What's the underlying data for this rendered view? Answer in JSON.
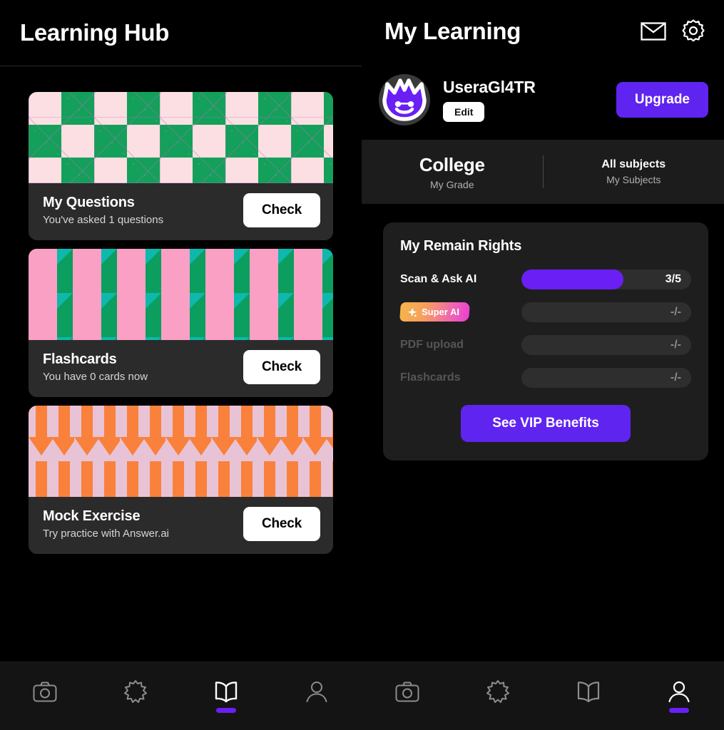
{
  "left": {
    "header_title": "Learning Hub",
    "cards": [
      {
        "title": "My Questions",
        "subtitle": "You've asked 1 questions",
        "button": "Check",
        "pattern": "diamond",
        "colors": {
          "bg": "#fbdfe2",
          "shape": "#14a05a",
          "line": "#b46ebe"
        }
      },
      {
        "title": "Flashcards",
        "subtitle": "You have 0 cards now",
        "button": "Check",
        "pattern": "checker",
        "colors": {
          "bg": "#0fb8ac",
          "shape": "#0b9e5e",
          "accent": "#f9a0c4"
        }
      },
      {
        "title": "Mock Exercise",
        "subtitle": "Try practice with Answer.ai",
        "button": "Check",
        "pattern": "arrows",
        "colors": {
          "bg": "#e8c3d6",
          "shape": "#f9813c"
        }
      }
    ],
    "tabs": [
      {
        "icon": "camera-icon",
        "active": false
      },
      {
        "icon": "sparkle-burst-icon",
        "active": false
      },
      {
        "icon": "open-book-icon",
        "active": true
      },
      {
        "icon": "person-icon",
        "active": false
      }
    ]
  },
  "right": {
    "header_title": "My Learning",
    "header_icons": [
      {
        "name": "mail-icon"
      },
      {
        "name": "gear-icon"
      }
    ],
    "profile": {
      "username": "UseraGl4TR",
      "edit_label": "Edit",
      "upgrade_label": "Upgrade",
      "avatar_name": "purple-monster-avatar"
    },
    "segments": {
      "grade": {
        "value": "College",
        "label": "My Grade"
      },
      "subjects": {
        "value": "All subjects",
        "label": "My Subjects"
      }
    },
    "rights": {
      "title": "My Remain Rights",
      "rows": [
        {
          "label": "Scan & Ask AI",
          "value": "3/5",
          "progress": 60,
          "dim": false,
          "badge": null
        },
        {
          "label": "",
          "value": "-/-",
          "progress": 0,
          "dim": true,
          "badge": "Super AI"
        },
        {
          "label": "PDF upload",
          "value": "-/-",
          "progress": 0,
          "dim": true,
          "badge": null
        },
        {
          "label": "Flashcards",
          "value": "-/-",
          "progress": 0,
          "dim": true,
          "badge": null
        }
      ],
      "vip_button": "See VIP Benefits"
    },
    "tabs": [
      {
        "icon": "camera-icon",
        "active": false
      },
      {
        "icon": "sparkle-burst-icon",
        "active": false
      },
      {
        "icon": "open-book-icon",
        "active": false
      },
      {
        "icon": "person-icon",
        "active": true
      }
    ]
  },
  "theme": {
    "accent_purple": "#6a1ff5",
    "button_purple": "#6024f0",
    "bg_black": "#000000",
    "card_dark": "#2b2b2b",
    "panel_dark": "#1e1e1e",
    "segment_dark": "#1c1c1c",
    "tabbar_dark": "#141414"
  }
}
